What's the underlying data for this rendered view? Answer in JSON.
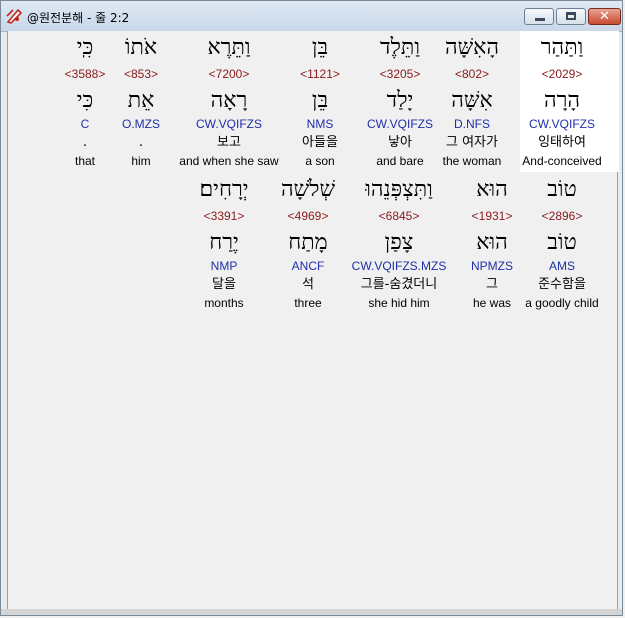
{
  "window": {
    "title": "@원전분해 - 줄 2:2",
    "close_glyph": "✕"
  },
  "rows": [
    {
      "words": [
        {
          "surface": "כִּֽי",
          "strong": "<3588>",
          "lemma": "כִּי",
          "morph": "C",
          "kor": ".",
          "eng": "that"
        },
        {
          "surface": "אֹתוֹ",
          "strong": "<853>",
          "lemma": "אֵת",
          "morph": "O.MZS",
          "kor": ".",
          "eng": "him"
        },
        {
          "surface": "וַתֵּרֶא",
          "strong": "<7200>",
          "lemma": "רָאָה",
          "morph": "CW.VQIFZS",
          "kor": "보고",
          "eng": "and when she saw"
        },
        {
          "surface": "בֵּן",
          "strong": "<1121>",
          "lemma": "בֵּן",
          "morph": "NMS",
          "kor": "아들을",
          "eng": "a son"
        },
        {
          "surface": "וַתֵּלֶד",
          "strong": "<3205>",
          "lemma": "יָלַד",
          "morph": "CW.VQIFZS",
          "kor": "낳아",
          "eng": "and bare"
        },
        {
          "surface": "הָאִשָּׁה",
          "strong": "<802>",
          "lemma": "אִשָּׁה",
          "morph": "D.NFS",
          "kor": "그 여자가",
          "eng": "the woman"
        },
        {
          "surface": "וַתַּהַר",
          "strong": "<2029>",
          "lemma": "הָרָה",
          "morph": "CW.VQIFZS",
          "kor": "잉태하여",
          "eng": "And-conceived"
        }
      ]
    },
    {
      "words": [
        {
          "surface": "יְרָחִים׃",
          "strong": "<3391>",
          "lemma": "יֶרַח",
          "morph": "NMP",
          "kor": "달을",
          "eng": "months"
        },
        {
          "surface": "שְׁלֹשָׁה",
          "strong": "<4969>",
          "lemma": "מָתַח",
          "morph": "ANCF",
          "kor": "석",
          "eng": "three"
        },
        {
          "surface": "וַתִּצְפְּנֵהוּ",
          "strong": "<6845>",
          "lemma": "צָפַן",
          "morph": "CW.VQIFZS.MZS",
          "kor": "그를-숨겼더니",
          "eng": "she hid him"
        },
        {
          "surface": "הוּא",
          "strong": "<1931>",
          "lemma": "הוּא",
          "morph": "NPMZS",
          "kor": "그",
          "eng": "he was"
        },
        {
          "surface": "טוֹב",
          "strong": "<2896>",
          "lemma": "טוֹב",
          "morph": "AMS",
          "kor": "준수함을",
          "eng": "a goodly child"
        }
      ]
    }
  ]
}
